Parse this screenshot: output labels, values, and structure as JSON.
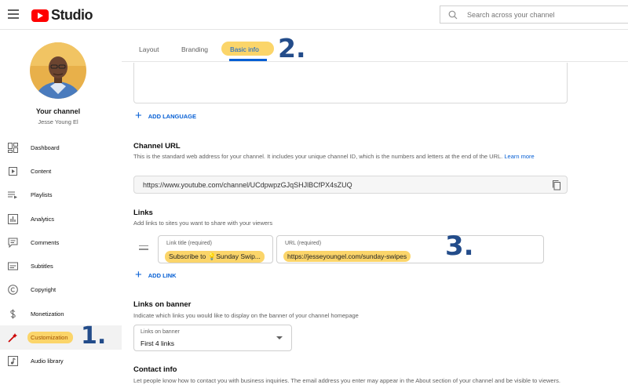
{
  "header": {
    "logo_text": "Studio",
    "search_placeholder": "Search across your channel"
  },
  "sidebar": {
    "your_channel": "Your channel",
    "channel_name": "Jesse Young El",
    "items": [
      {
        "label": "Dashboard",
        "icon": "dashboard-icon"
      },
      {
        "label": "Content",
        "icon": "content-icon"
      },
      {
        "label": "Playlists",
        "icon": "playlists-icon"
      },
      {
        "label": "Analytics",
        "icon": "analytics-icon"
      },
      {
        "label": "Comments",
        "icon": "comments-icon"
      },
      {
        "label": "Subtitles",
        "icon": "subtitles-icon"
      },
      {
        "label": "Copyright",
        "icon": "copyright-icon"
      },
      {
        "label": "Monetization",
        "icon": "monetization-icon"
      },
      {
        "label": "Customization",
        "icon": "customization-icon",
        "active": true
      },
      {
        "label": "Audio library",
        "icon": "audio-library-icon"
      }
    ]
  },
  "annotations": {
    "step1": "1.",
    "step2": "2.",
    "step3": "3."
  },
  "tabs": [
    {
      "label": "Layout"
    },
    {
      "label": "Branding"
    },
    {
      "label": "Basic info",
      "active": true
    }
  ],
  "main": {
    "add_language": "ADD LANGUAGE",
    "channel_url": {
      "title": "Channel URL",
      "desc": "This is the standard web address for your channel. It includes your unique channel ID, which is the numbers and letters at the end of the URL.",
      "learn_more": "Learn more",
      "value": "https://www.youtube.com/channel/UCdpwpzGJqSHJlBCfPX4sZUQ"
    },
    "links": {
      "title": "Links",
      "desc": "Add links to sites you want to share with your viewers",
      "link_title_label": "Link title (required)",
      "link_title_value": "Subscribe to 💡Sunday Swip...",
      "url_label": "URL (required)",
      "url_value": "https://jesseyoungel.com/sunday-swipes",
      "add_link": "ADD LINK"
    },
    "links_on_banner": {
      "title": "Links on banner",
      "desc": "Indicate which links you would like to display on the banner of your channel homepage",
      "select_label": "Links on banner",
      "select_value": "First 4 links"
    },
    "contact": {
      "title": "Contact info",
      "desc": "Let people know how to contact you with business inquiries. The email address you enter may appear in the About section of your channel and be visible to viewers."
    }
  },
  "colors": {
    "accent_blue": "#065fd4",
    "highlight_yellow": "#fbd56a",
    "annotation_blue": "#234c8a",
    "brand_red": "#ff0000"
  }
}
